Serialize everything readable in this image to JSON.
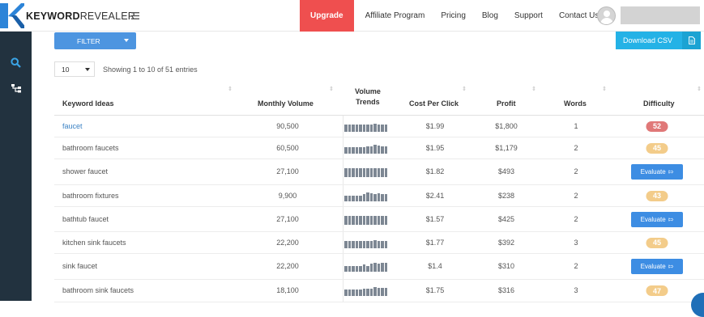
{
  "brand": {
    "bold": "KEYWORD",
    "light": "REVEALER"
  },
  "nav": {
    "upgrade": "Upgrade",
    "links": [
      "Affiliate Program",
      "Pricing",
      "Blog",
      "Support",
      "Contact Us"
    ]
  },
  "toolbar": {
    "filter_label": "FILTER",
    "csv_label": "Download CSV"
  },
  "entries": {
    "selected": "10",
    "info": "Showing 1 to 10 of 51 entries"
  },
  "table": {
    "headers": {
      "keyword": "Keyword Ideas",
      "volume": "Monthly Volume",
      "trends_line1": "Volume",
      "trends_line2": "Trends",
      "cpc": "Cost Per Click",
      "profit": "Profit",
      "words": "Words",
      "difficulty": "Difficulty"
    },
    "evaluate_label": "Evaluate",
    "rows": [
      {
        "keyword": "faucet",
        "volume": "90,500",
        "cpc": "$1.99",
        "profit": "$1,800",
        "words": "1",
        "difficulty": "52",
        "trend": [
          0.8,
          0.8,
          0.8,
          0.8,
          0.8,
          0.8,
          0.8,
          0.8,
          0.9,
          0.8,
          0.8,
          0.8
        ]
      },
      {
        "keyword": "bathroom faucets",
        "volume": "60,500",
        "cpc": "$1.95",
        "profit": "$1,179",
        "words": "2",
        "difficulty": "45",
        "trend": [
          0.7,
          0.7,
          0.7,
          0.7,
          0.7,
          0.7,
          0.8,
          0.8,
          1.0,
          0.9,
          0.8,
          0.8
        ]
      },
      {
        "keyword": "shower faucet",
        "volume": "27,100",
        "cpc": "$1.82",
        "profit": "$493",
        "words": "2",
        "difficulty": null,
        "trend": [
          1.0,
          1.0,
          1.0,
          1.0,
          1.0,
          1.0,
          1.0,
          1.0,
          1.0,
          1.0,
          1.0,
          1.0
        ]
      },
      {
        "keyword": "bathroom fixtures",
        "volume": "9,900",
        "cpc": "$2.41",
        "profit": "$238",
        "words": "2",
        "difficulty": "43",
        "trend": [
          0.6,
          0.6,
          0.6,
          0.6,
          0.6,
          0.8,
          1.0,
          0.9,
          0.8,
          0.9,
          0.8,
          0.8
        ]
      },
      {
        "keyword": "bathtub faucet",
        "volume": "27,100",
        "cpc": "$1.57",
        "profit": "$425",
        "words": "2",
        "difficulty": null,
        "trend": [
          1.0,
          1.0,
          1.0,
          1.0,
          1.0,
          1.0,
          1.0,
          1.0,
          1.0,
          1.0,
          1.0,
          1.0
        ]
      },
      {
        "keyword": "kitchen sink faucets",
        "volume": "22,200",
        "cpc": "$1.77",
        "profit": "$392",
        "words": "3",
        "difficulty": "45",
        "trend": [
          0.8,
          0.8,
          0.8,
          0.8,
          0.8,
          0.8,
          0.8,
          0.8,
          0.9,
          0.8,
          0.8,
          0.8
        ]
      },
      {
        "keyword": "sink faucet",
        "volume": "22,200",
        "cpc": "$1.4",
        "profit": "$310",
        "words": "2",
        "difficulty": null,
        "trend": [
          0.6,
          0.6,
          0.6,
          0.6,
          0.6,
          0.8,
          0.6,
          0.9,
          1.0,
          0.9,
          1.0,
          1.0
        ]
      },
      {
        "keyword": "bathroom sink faucets",
        "volume": "18,100",
        "cpc": "$1.75",
        "profit": "$316",
        "words": "3",
        "difficulty": "47",
        "trend": [
          0.7,
          0.7,
          0.7,
          0.7,
          0.7,
          0.8,
          0.8,
          0.8,
          1.0,
          0.9,
          0.9,
          0.9
        ]
      }
    ]
  },
  "colors": {
    "difficulty_red": "#e07878",
    "difficulty_amber": "#f3cc8a",
    "accent": "#4d95e0",
    "csv": "#24b2e6",
    "upgrade": "#ef4f4f",
    "sidebar": "#22323f"
  }
}
